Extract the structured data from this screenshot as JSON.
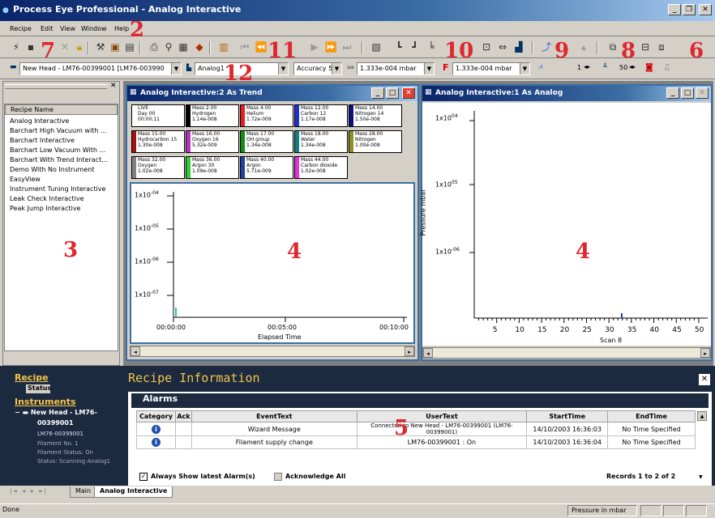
{
  "window": {
    "title": "Process Eye Professional - Analog Interactive"
  },
  "menu": {
    "recipe": "Recipe",
    "edit": "Edit",
    "view": "View",
    "window": "Window",
    "help": "Help"
  },
  "annotations": {
    "n2": "2",
    "n3": "3",
    "n4a": "4",
    "n4b": "4",
    "n5": "5",
    "n6": "6",
    "n7": "7",
    "n8": "8",
    "n9": "9",
    "n10": "10",
    "n11": "11",
    "n12": "12"
  },
  "toolbar2": {
    "head": "New Head - LM76-00399001 [LM76-003990",
    "analog": "Analog1",
    "accuracy": "Accuracy 5",
    "pressure1": "1.333e-004 mbar",
    "pressure2": "1.333e-004 mbar",
    "val1": "1",
    "val2": "50"
  },
  "recipes": {
    "header": "Recipe Name",
    "items": [
      "Analog Interactive",
      "Barchart High Vacuum with ...",
      "Barchart Interactive",
      "Barchart Low Vacuum With ...",
      "Barchart With Trend Interact...",
      "Demo With No Instrument",
      "EasyView",
      "Instrument Tuning Interactive",
      "Leak Check Interactive",
      "Peak Jump Interactive"
    ]
  },
  "trend": {
    "title": "Analog Interactive:2 As Trend",
    "boxes": [
      {
        "l1": "LIVE",
        "l2": "Day 00",
        "l3": "00:00:11",
        "color": "#ffffff"
      },
      {
        "l1": "Mass 2.00",
        "l2": "Hydrogen",
        "l3": "1.14e-008",
        "color": "#000000"
      },
      {
        "l1": "Mass 4.00",
        "l2": "Helium",
        "l3": "1.72e-009",
        "color": "#e02020"
      },
      {
        "l1": "Mass 12.00",
        "l2": "Carbon 12",
        "l3": "1.17e-008",
        "color": "#2030d0"
      },
      {
        "l1": "Mass 14.00",
        "l2": "Nitrogen 14",
        "l3": "1.50e-008",
        "color": "#101080"
      },
      {
        "l1": "Mass 15.00",
        "l2": "Hydrocarbon 15",
        "l3": "1.30e-008",
        "color": "#a01010"
      },
      {
        "l1": "Mass 16.00",
        "l2": "Oxygen 16",
        "l3": "5.32e-009",
        "color": "#c030c0"
      },
      {
        "l1": "Mass 17.00",
        "l2": "OH group",
        "l3": "1.34e-008",
        "color": "#109010"
      },
      {
        "l1": "Mass 18.00",
        "l2": "Water",
        "l3": "1.34e-008",
        "color": "#108080"
      },
      {
        "l1": "Mass 28.00",
        "l2": "Nitrogen",
        "l3": "1.00e-008",
        "color": "#909020"
      },
      {
        "l1": "Mass 32.00",
        "l2": "Oxygen",
        "l3": "1.02e-008",
        "color": "#808080"
      },
      {
        "l1": "Mass 36.00",
        "l2": "Argon 30",
        "l3": "1.09e-008",
        "color": "#30d030"
      },
      {
        "l1": "Mass 40.00",
        "l2": "Argon",
        "l3": "5.71e-009",
        "color": "#2040a0"
      },
      {
        "l1": "Mass 44.00",
        "l2": "Carbon dioxide",
        "l3": "1.02e-008",
        "color": "#e030e0"
      }
    ]
  },
  "chart_data": [
    {
      "type": "line",
      "title": "Analog Interactive:2 As Trend",
      "xlabel": "Elapsed Time",
      "ylabel": "",
      "x_ticks": [
        "00:00:00",
        "00:05:00",
        "00:10:00"
      ],
      "y_ticks": [
        "1x10^-4",
        "1x10^-5",
        "1x10^-6",
        "1x10^-7"
      ],
      "yscale": "log",
      "series": []
    },
    {
      "type": "line",
      "title": "Analog Interactive:1 As Analog",
      "xlabel": "Scan 8",
      "ylabel": "Pressure mbar",
      "x_ticks": [
        5,
        10,
        15,
        20,
        25,
        30,
        35,
        40,
        45,
        50
      ],
      "y_ticks": [
        "1x10^-4",
        "1x10^-5",
        "1x10^-6"
      ],
      "yscale": "log",
      "series": []
    }
  ],
  "trendtext": {
    "y1": "1x10",
    "e1": "-04",
    "y2": "1x10",
    "e2": "-05",
    "y3": "1x10",
    "e3": "-06",
    "y4": "1x10",
    "e4": "-07",
    "x1": "00:00:00",
    "x2": "00:05:00",
    "x3": "00:10:00",
    "xlabel": "Elapsed Time"
  },
  "analog": {
    "title": "Analog Interactive:1 As Analog",
    "ylabel": "Pressure mbar",
    "xlabel": "Scan 8",
    "y1": "1x10",
    "e1": "04",
    "y2": "1x10",
    "e2": "05",
    "y3": "1x10",
    "e3": "-06",
    "xticks": [
      "5",
      "10",
      "15",
      "20",
      "25",
      "30",
      "35",
      "40",
      "45",
      "50"
    ]
  },
  "nav": {
    "recipe": "Recipe",
    "status": "Status",
    "instruments": "Instruments",
    "head": "New Head - LM76-",
    "head2": "00399001",
    "id": "LM76-00399001",
    "filament": "Filament No. 1",
    "fstatus": "Filament Status: On",
    "status2": "Status: Scanning Analog1"
  },
  "info": {
    "title": "Recipe Information",
    "alarms": "Alarms",
    "cols": [
      "Category",
      "Ack",
      "EventText",
      "UserText",
      "StartTime",
      "EndTime"
    ],
    "rows": [
      {
        "event": "Wizard Message",
        "user": "Connected to New Head - LM76-00399001 (LM76-00399001)",
        "start": "14/10/2003 16:36:03",
        "end": "No Time Specified"
      },
      {
        "event": "Filament supply change",
        "user": "LM76-00399001 : On",
        "start": "14/10/2003 16:36:04",
        "end": "No Time Specified"
      }
    ],
    "always": "Always Show latest Alarm(s)",
    "ack": "Acknowledge All",
    "records": "Records 1 to 2 of 2"
  },
  "tabs": {
    "main": "Main",
    "analog": "Analog Interactive"
  },
  "status": {
    "left": "Done",
    "right": "Pressure in mbar"
  }
}
